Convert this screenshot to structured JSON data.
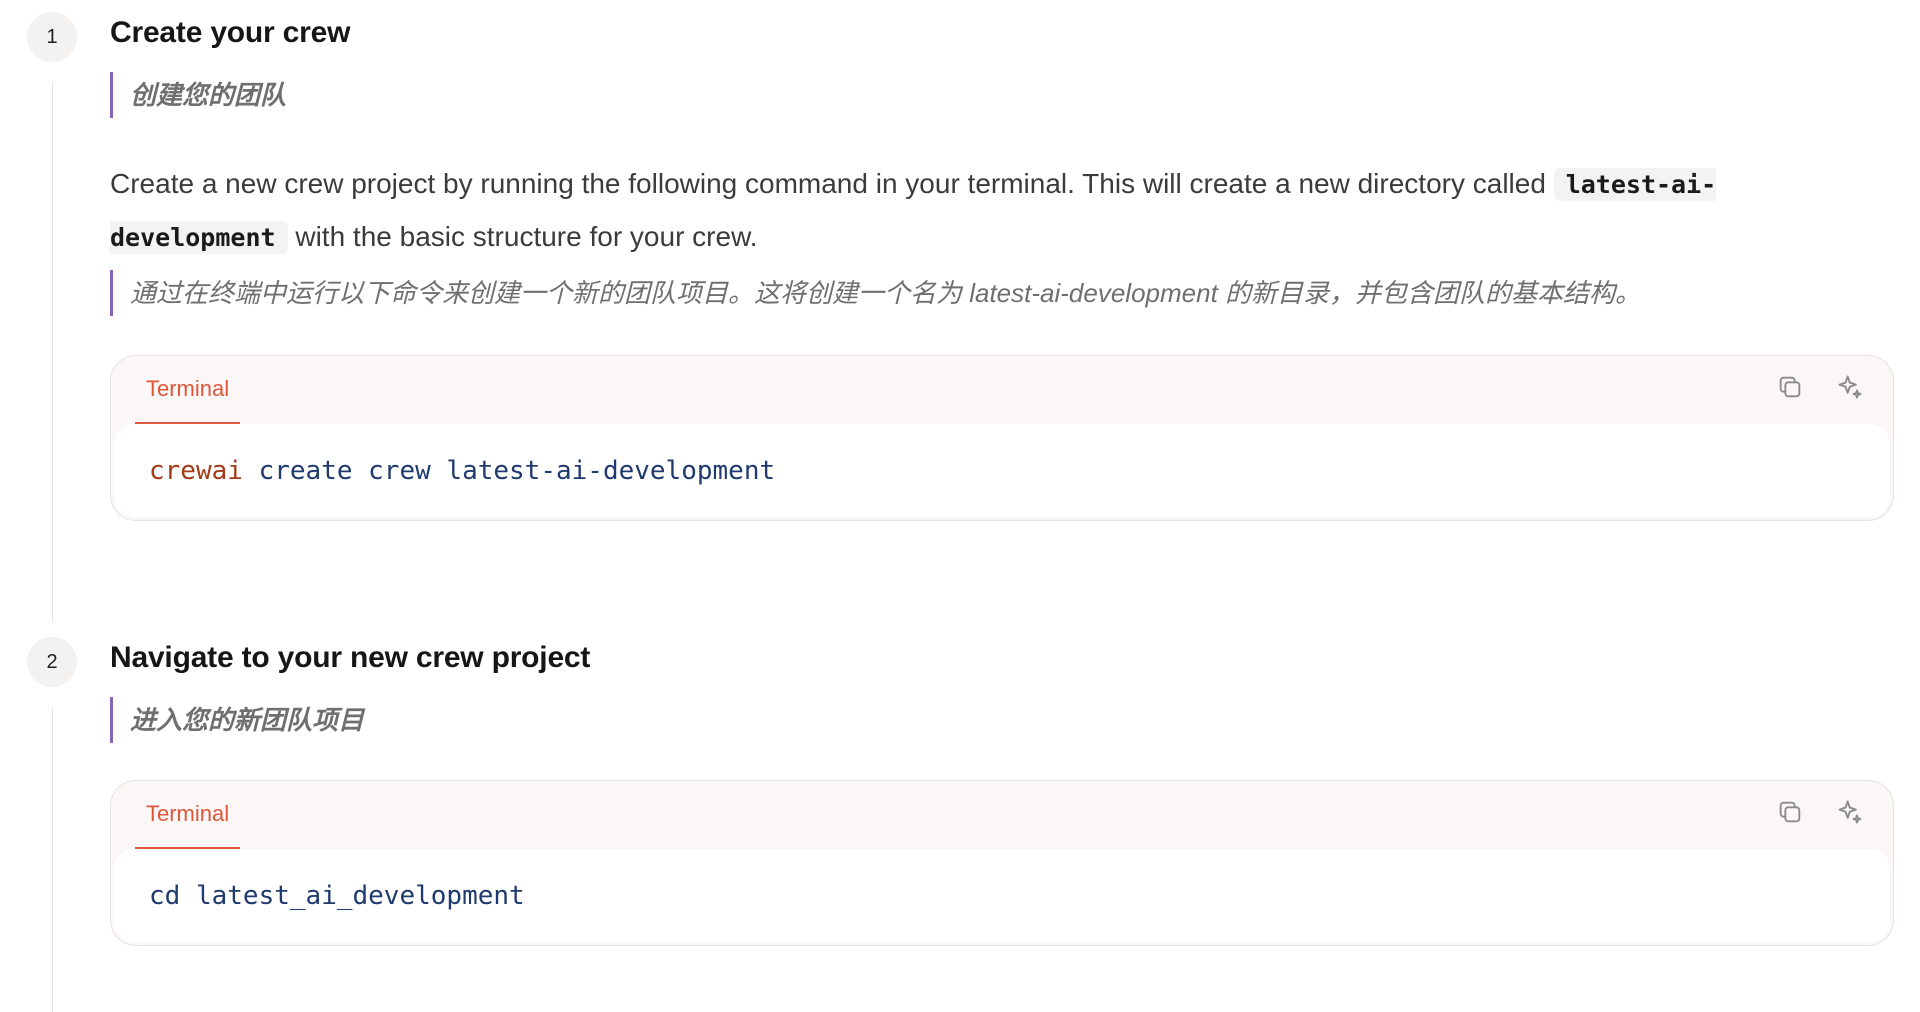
{
  "steps": [
    {
      "number": "1",
      "title": "Create your crew",
      "title_zh": "创建您的团队",
      "paragraph": {
        "before": "Create a new crew project by running the following command in your terminal. This will create a new directory called ",
        "code": "latest-ai-development",
        "after": " with the basic structure for your crew."
      },
      "paragraph_zh": "通过在终端中运行以下命令来创建一个新的团队项目。这将创建一个名为 latest-ai-development 的新目录，并包含团队的基本结构。",
      "code_block": {
        "tab": "Terminal",
        "command": "crewai",
        "args": " create crew latest-ai-development",
        "copy_icon": "copy-icon",
        "ai_icon": "sparkle-icon"
      }
    },
    {
      "number": "2",
      "title": "Navigate to your new crew project",
      "title_zh": "进入您的新团队项目",
      "code_block": {
        "tab": "Terminal",
        "command": "cd",
        "args": " latest_ai_development",
        "copy_icon": "copy-icon",
        "ai_icon": "sparkle-icon"
      }
    }
  ],
  "colors": {
    "accent": "#e0563b",
    "quote_bar": "#8a63b8",
    "code_command": "#a23b1a",
    "code_text": "#1f3a6e"
  }
}
